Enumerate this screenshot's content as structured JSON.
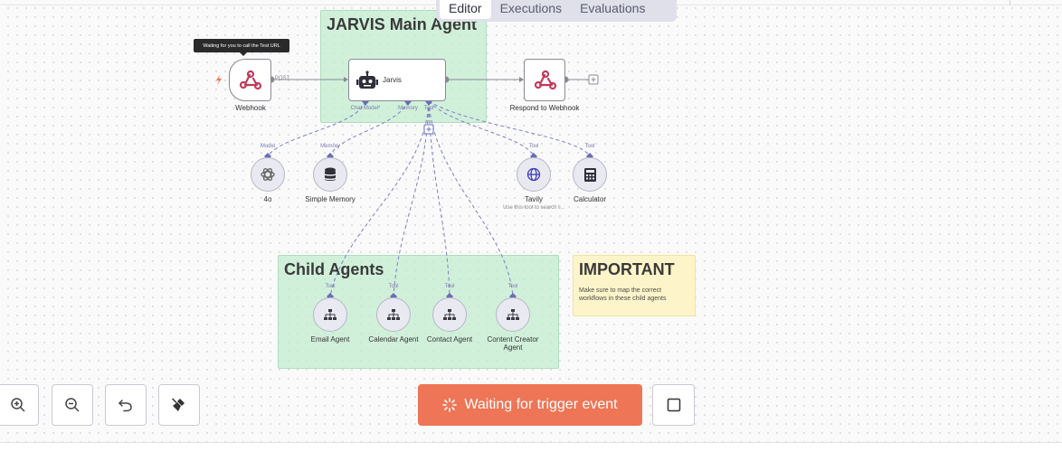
{
  "tabs": {
    "editor": "Editor",
    "executions": "Executions",
    "evaluations": "Evaluations",
    "active": "Editor"
  },
  "stickies": {
    "main_agent": {
      "title": "JARVIS Main Agent"
    },
    "child_agents": {
      "title": "Child Agents"
    },
    "important": {
      "title": "IMPORTANT",
      "body": "Make sure to map the correct workflows in these child agents"
    }
  },
  "tooltip": "Waiting for you to call the Test URL",
  "nodes": {
    "webhook": {
      "label": "Webhook",
      "port_out": "POST"
    },
    "jarvis": {
      "label": "Jarvis",
      "ports": {
        "chat_model": "Chat Model*",
        "memory": "Memory",
        "tool": "Tool"
      }
    },
    "respond": {
      "label": "Respond to Webhook"
    },
    "model_4o": {
      "label": "4o",
      "port": "Model"
    },
    "simple_memory": {
      "label": "Simple Memory",
      "port": "Memory"
    },
    "tavily": {
      "label": "Tavily",
      "port": "Tool",
      "subtitle": "Use this tool to search t..."
    },
    "calculator": {
      "label": "Calculator",
      "port": "Tool"
    },
    "email_agent": {
      "label": "Email Agent",
      "port": "Tool"
    },
    "calendar_agent": {
      "label": "Calendar Agent",
      "port": "Tool"
    },
    "contact_agent": {
      "label": "Contact Agent",
      "port": "Tool"
    },
    "content_creator_agent": {
      "label": "Content Creator Agent",
      "port": "Tool"
    }
  },
  "controls": {
    "zoom_in": "zoom-in-icon",
    "zoom_out": "zoom-out-icon",
    "undo": "undo-icon",
    "tidy": "broom-icon",
    "trigger_button": "Waiting for trigger event",
    "stop": "square-icon"
  },
  "colors": {
    "accent": "#ee7556",
    "edge": "#6b6db8",
    "sticky_green": "#c1ebcd",
    "sticky_yellow": "#fdf5c9"
  }
}
